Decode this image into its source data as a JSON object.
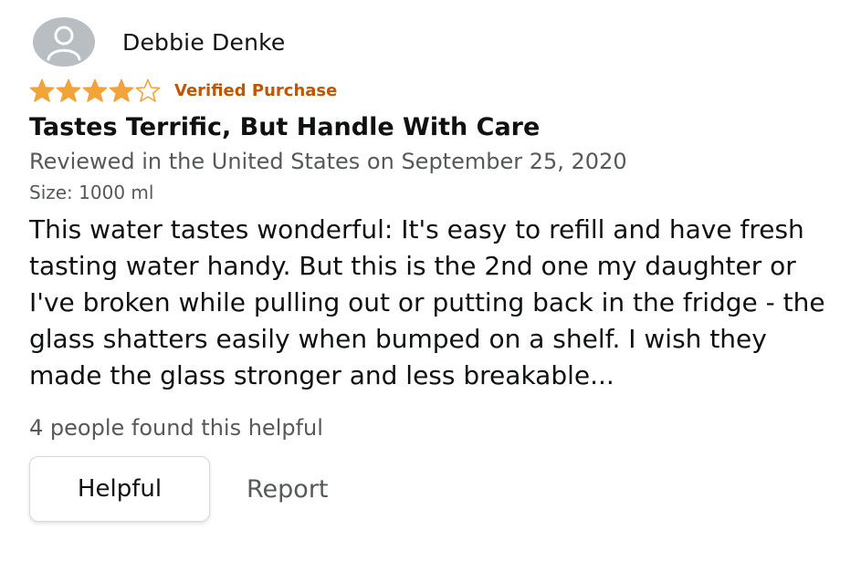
{
  "review": {
    "author": "Debbie Denke",
    "rating": 4,
    "rating_max": 5,
    "verified_label": "Verified Purchase",
    "title": "Tastes Terrific, But Handle With Care",
    "reviewed_line": "Reviewed in the United States on September 25, 2020",
    "size_line": "Size: 1000 ml",
    "body": "This water tastes wonderful: It's easy to refill and have fresh tasting water handy. But this is the 2nd one my daughter or I've broken while pulling out or putting back in the fridge - the glass shatters easily when bumped on a shelf. I wish they made the glass stronger and less breakable...",
    "helpful_count_text": "4 people found this helpful"
  },
  "actions": {
    "helpful_label": "Helpful",
    "report_label": "Report"
  },
  "colors": {
    "star": "#f2a33a",
    "verified": "#c45500",
    "meta": "#565959",
    "avatar": "#b8bec2"
  },
  "icons": {
    "avatar": "default-profile-avatar-icon",
    "star_full": "star-filled-icon",
    "star_empty": "star-outline-icon"
  }
}
